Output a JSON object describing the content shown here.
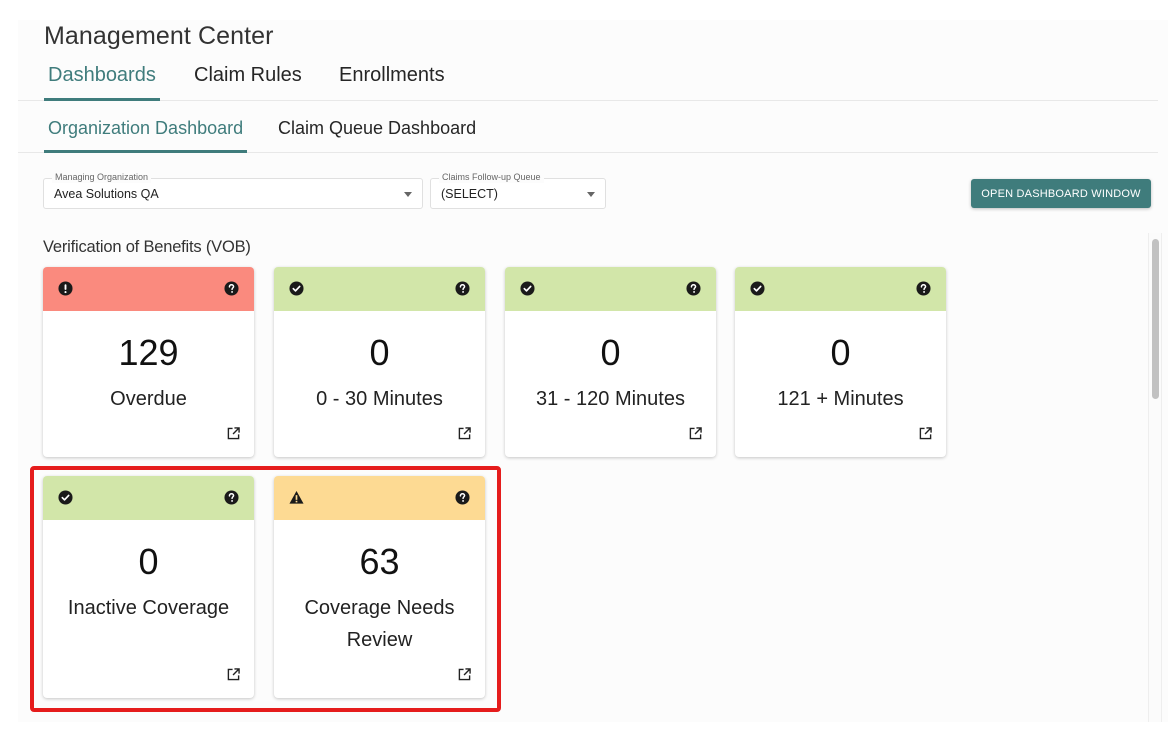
{
  "app": {
    "title": "Management Center"
  },
  "main_tabs": [
    {
      "label": "Dashboards",
      "active": true
    },
    {
      "label": "Claim Rules",
      "active": false
    },
    {
      "label": "Enrollments",
      "active": false
    }
  ],
  "sub_tabs": [
    {
      "label": "Organization Dashboard",
      "active": true
    },
    {
      "label": "Claim Queue Dashboard",
      "active": false
    }
  ],
  "filters": {
    "managing_org": {
      "label": "Managing Organization",
      "value": "Avea Solutions QA"
    },
    "followup_queue": {
      "label": "Claims Follow-up Queue",
      "value": "(SELECT)"
    }
  },
  "toolbar": {
    "open_dashboard_label": "OPEN DASHBOARD WINDOW"
  },
  "section": {
    "title": "Verification of Benefits (VOB)"
  },
  "colors": {
    "accent": "#3f7c7c",
    "status_error": "#fa8a7e",
    "status_ok": "#d2e6a9",
    "status_warning": "#fdda93",
    "highlight": "#e51c1c"
  },
  "cards": [
    {
      "count": "129",
      "label": "Overdue",
      "status": "error",
      "status_icon": "alert-circle-icon"
    },
    {
      "count": "0",
      "label": "0 - 30 Minutes",
      "status": "ok",
      "status_icon": "check-circle-icon"
    },
    {
      "count": "0",
      "label": "31 - 120 Minutes",
      "status": "ok",
      "status_icon": "check-circle-icon"
    },
    {
      "count": "0",
      "label": "121 + Minutes",
      "status": "ok",
      "status_icon": "check-circle-icon"
    },
    {
      "count": "0",
      "label": "Inactive Coverage",
      "status": "ok",
      "status_icon": "check-circle-icon"
    },
    {
      "count": "63",
      "label": "Coverage Needs Review",
      "status": "warning",
      "status_icon": "warning-triangle-icon"
    }
  ]
}
